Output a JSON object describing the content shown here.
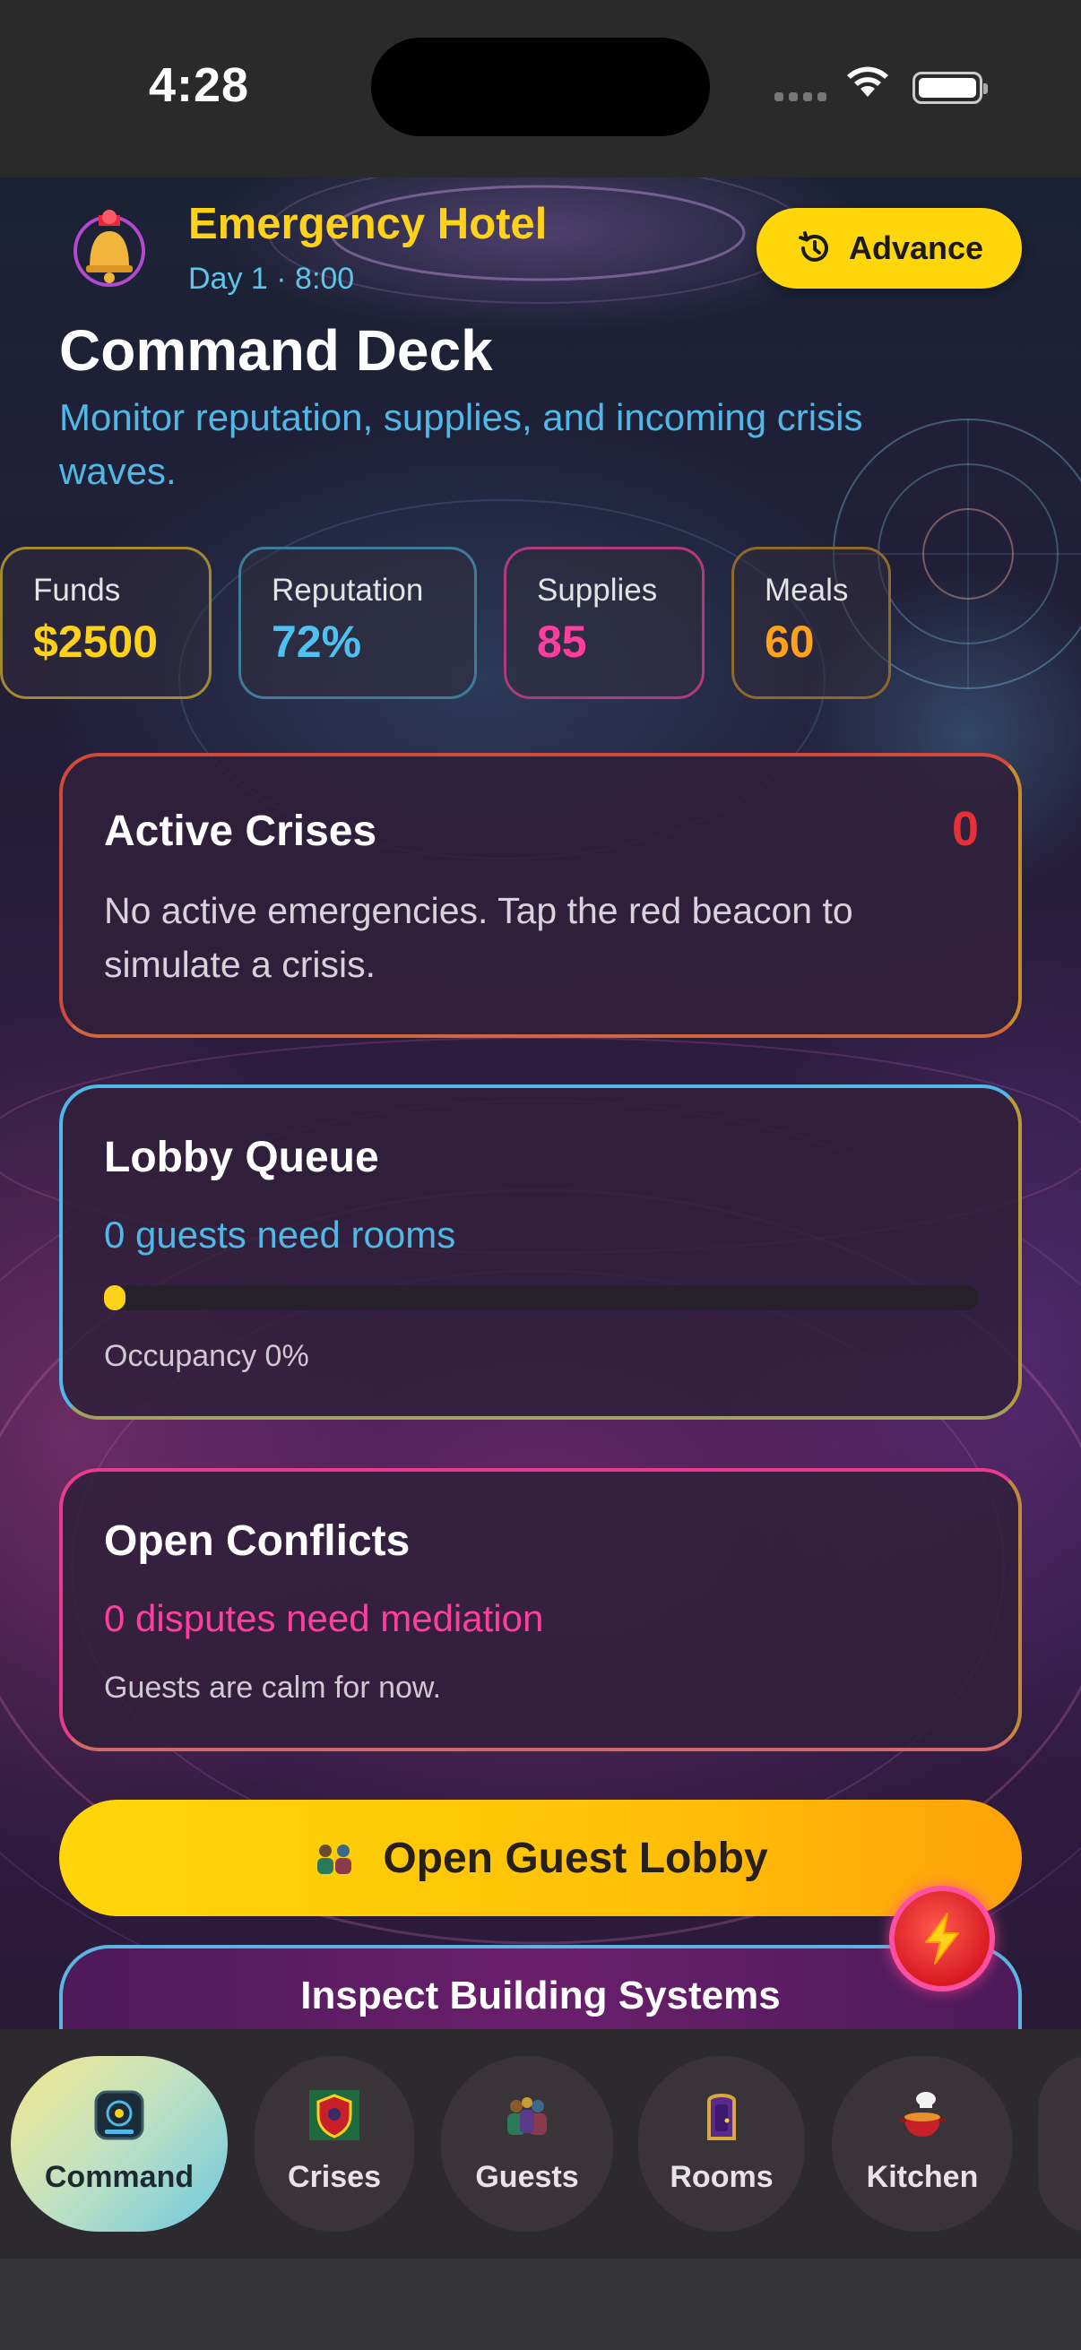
{
  "status_bar": {
    "time": "4:28"
  },
  "header": {
    "app_title": "Emergency Hotel",
    "subtitle": "Day 1 · 8:00",
    "advance_label": "Advance"
  },
  "page": {
    "title": "Command Deck",
    "description": "Monitor reputation, supplies, and incoming crisis waves."
  },
  "stats": [
    {
      "label": "Funds",
      "value": "$2500",
      "color": "#ffd21a",
      "border": "#a38a2e"
    },
    {
      "label": "Reputation",
      "value": "72%",
      "color": "#4fc1f0",
      "border": "#3e7d99"
    },
    {
      "label": "Supplies",
      "value": "85",
      "color": "#ff3ea0",
      "border": "#b03a7a"
    },
    {
      "label": "Meals",
      "value": "60",
      "color": "#ffa11a",
      "border": "#8e6a2a"
    }
  ],
  "active_crises": {
    "title": "Active Crises",
    "count": "0",
    "message": "No active emergencies. Tap the red beacon to simulate a crisis."
  },
  "lobby_queue": {
    "title": "Lobby Queue",
    "guests_text": "0 guests need rooms",
    "occupancy_fraction": 0,
    "occupancy_text": "Occupancy 0%"
  },
  "open_conflicts": {
    "title": "Open Conflicts",
    "disputes_text": "0 disputes need mediation",
    "note": "Guests are calm for now."
  },
  "actions": {
    "lobby_label": "Open Guest Lobby",
    "systems_label": "Inspect Building Systems"
  },
  "tabs": [
    {
      "label": "Command",
      "icon": "command-console-icon",
      "active": true
    },
    {
      "label": "Crises",
      "icon": "crisis-shield-icon",
      "active": false
    },
    {
      "label": "Guests",
      "icon": "guests-group-icon",
      "active": false
    },
    {
      "label": "Rooms",
      "icon": "room-door-icon",
      "active": false
    },
    {
      "label": "Kitchen",
      "icon": "kitchen-pot-icon",
      "active": false
    }
  ],
  "colors": {
    "accent_yellow": "#ffd21a",
    "accent_blue": "#4fb8e6",
    "accent_pink": "#ff3ea0",
    "alert_red": "#e5303a"
  }
}
